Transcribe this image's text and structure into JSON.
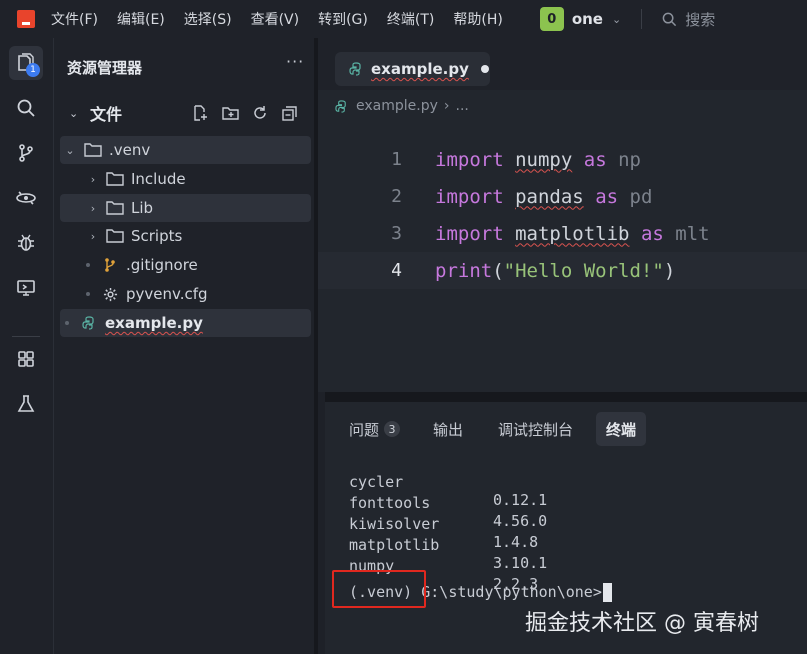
{
  "menubar": {
    "items": [
      "文件(F)",
      "编辑(E)",
      "选择(S)",
      "查看(V)",
      "转到(G)",
      "终端(T)",
      "帮助(H)"
    ],
    "project_badge": "0",
    "project_name": "one",
    "search_placeholder": "搜索"
  },
  "activitybar": {
    "explorer_badge": "1"
  },
  "sidebar": {
    "title": "资源管理器",
    "more": "···",
    "section_label": "文件",
    "tree": {
      "venv": ".venv",
      "include": "Include",
      "lib": "Lib",
      "scripts": "Scripts",
      "gitignore": ".gitignore",
      "pyvenv": "pyvenv.cfg",
      "example": "example.py"
    }
  },
  "editor": {
    "tab_label": "example.py",
    "breadcrumb_file": "example.py",
    "breadcrumb_sep": "›",
    "breadcrumb_more": "...",
    "lines": [
      {
        "n": "1",
        "kw": "import",
        "mod": "numpy",
        "as": "as",
        "alias": "np"
      },
      {
        "n": "2",
        "kw": "import",
        "mod": "pandas",
        "as": "as",
        "alias": "pd"
      },
      {
        "n": "3",
        "kw": "import",
        "mod": "matplotlib",
        "as": "as",
        "alias": "mlt"
      },
      {
        "n": "4",
        "fn": "print",
        "open": "(",
        "str": "\"Hello World!\"",
        "close": ")"
      }
    ]
  },
  "panel": {
    "tabs": {
      "problems": "问题",
      "problems_count": "3",
      "output": "输出",
      "debug_console": "调试控制台",
      "terminal": "终端"
    },
    "packages": [
      {
        "name": "cycler",
        "version": "0.12.1"
      },
      {
        "name": "fonttools",
        "version": "4.56.0"
      },
      {
        "name": "kiwisolver",
        "version": "1.4.8"
      },
      {
        "name": "matplotlib",
        "version": "3.10.1"
      },
      {
        "name": "numpy",
        "version": "2.2.3"
      }
    ],
    "prompt_env": "(.venv)",
    "prompt_path": " G:\\study\\python\\one>"
  },
  "watermark": "掘金技术社区 @ 寅春树",
  "colors": {
    "accent_red": "#e0281f",
    "project_green": "#8cc34f",
    "keyword": "#c678dd",
    "string": "#98c379",
    "badge_blue": "#3c7bf0"
  }
}
